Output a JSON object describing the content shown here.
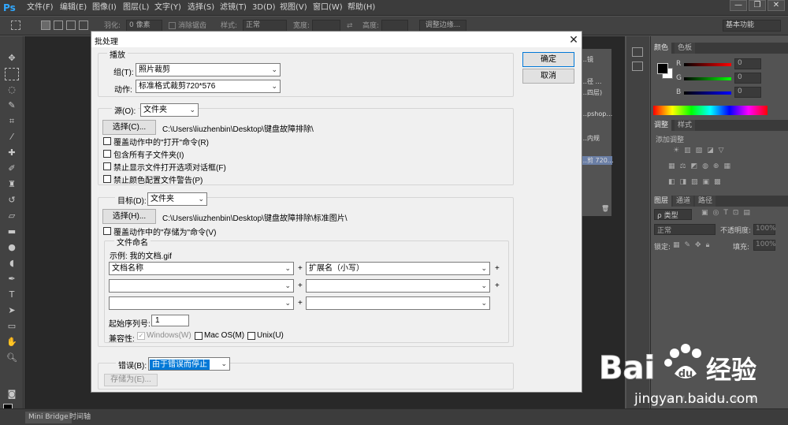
{
  "app": {
    "logo": "Ps"
  },
  "menubar": {
    "items": [
      "文件(F)",
      "编辑(E)",
      "图像(I)",
      "图层(L)",
      "文字(Y)",
      "选择(S)",
      "滤镜(T)",
      "3D(D)",
      "视图(V)",
      "窗口(W)",
      "帮助(H)"
    ],
    "window_controls": [
      "—",
      "❐",
      "✕"
    ]
  },
  "options_bar": {
    "feather_label": "羽化:",
    "feather_value": "0 像素",
    "antialias_label": "消除锯齿",
    "style_label": "样式:",
    "style_value": "正常",
    "width_label": "宽度:",
    "height_label": "高度:",
    "refine_edge": "调整边缘...",
    "workspace": "基本功能"
  },
  "history_panel": {
    "items": [
      "…镜",
      "…径 …",
      "…四层)",
      "…pshop…",
      "…内规",
      "…剪 720…"
    ]
  },
  "color_panel": {
    "tabs": [
      "颜色",
      "色板"
    ],
    "channels": [
      {
        "label": "R",
        "value": "0"
      },
      {
        "label": "G",
        "value": "0"
      },
      {
        "label": "B",
        "value": "0"
      }
    ]
  },
  "adjust_panel": {
    "tabs": [
      "调整",
      "样式"
    ],
    "title": "添加调整"
  },
  "layers_panel": {
    "tabs": [
      "图层",
      "通道",
      "路径"
    ],
    "filter_label": "ρ 类型",
    "blend_mode": "正常",
    "opacity_label": "不透明度:",
    "opacity_value": "100%",
    "lock_label": "锁定:",
    "fill_label": "填充:",
    "fill_value": "100%"
  },
  "bottom_tabs": [
    "Mini Bridge",
    "时间轴"
  ],
  "dialog": {
    "title": "批处理",
    "ok": "确定",
    "cancel": "取消",
    "play": {
      "label": "播放",
      "group_label": "组(T):",
      "group_value": "照片裁剪",
      "action_label": "动作:",
      "action_value": "标准格式裁剪720*576"
    },
    "source": {
      "label": "源(O):",
      "value": "文件夹",
      "choose": "选择(C)...",
      "path": "C:\\Users\\liuzhenbin\\Desktop\\键盘故障排除\\",
      "checks": [
        "覆盖动作中的\"打开\"命令(R)",
        "包含所有子文件夹(I)",
        "禁止显示文件打开选项对话框(F)",
        "禁止颜色配置文件警告(P)"
      ]
    },
    "destination": {
      "label": "目标(D):",
      "value": "文件夹",
      "choose": "选择(H)...",
      "path": "C:\\Users\\liuzhenbin\\Desktop\\键盘故障排除\\标准图片\\",
      "override": "覆盖动作中的\"存储为\"命令(V)"
    },
    "naming": {
      "label": "文件命名",
      "example": "示例: 我的文档.gif",
      "row1_left": "文档名称",
      "row1_right": "扩展名（小写）",
      "plus": "+",
      "serial_label": "起始序列号:",
      "serial_value": "1",
      "compat_label": "兼容性:",
      "compat": [
        "Windows(W)",
        "Mac OS(M)",
        "Unix(U)"
      ]
    },
    "errors": {
      "label": "错误(B):",
      "value": "由于错误而停止",
      "save_as": "存储为(E)..."
    }
  },
  "watermark": {
    "text": "jingyan.baidu.com",
    "brand": "Bai 经验"
  }
}
